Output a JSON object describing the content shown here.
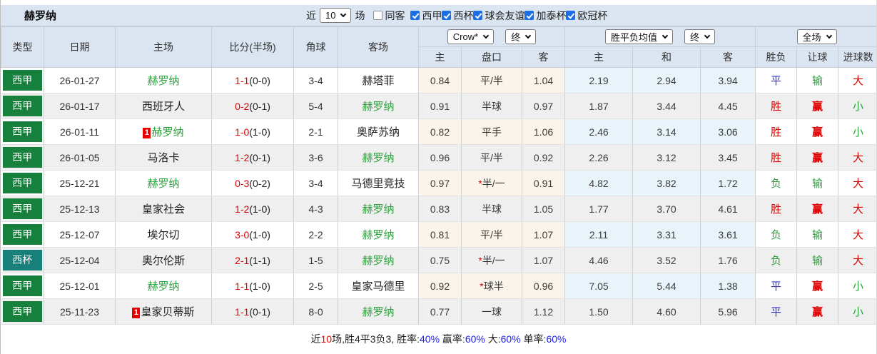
{
  "title": "赫罗纳",
  "filters": {
    "recent_label": "近",
    "recent_value": "10",
    "matches_label": "场",
    "same_away_label": "同客",
    "same_away_checked": false,
    "competitions": [
      {
        "label": "西甲",
        "checked": true
      },
      {
        "label": "西杯",
        "checked": true
      },
      {
        "label": "球会友谊",
        "checked": true
      },
      {
        "label": "加泰杯",
        "checked": true
      },
      {
        "label": "欧冠杯",
        "checked": true
      }
    ]
  },
  "controls": {
    "odds_source": "Crow*",
    "odds_source_time": "终",
    "avg_source": "胜平负均值",
    "avg_source_time": "终",
    "scope": "全场"
  },
  "columns": {
    "type": "类型",
    "date": "日期",
    "home": "主场",
    "score": "比分(半场)",
    "corner": "角球",
    "away": "客场",
    "odds_home": "主",
    "odds_handicap": "盘口",
    "odds_away": "客",
    "avg_home": "主",
    "avg_draw": "和",
    "avg_away": "客",
    "result": "胜负",
    "handicap_result": "让球",
    "goals": "进球数"
  },
  "rows": [
    {
      "comp": "西甲",
      "comp_type": "league",
      "date": "26-01-27",
      "home": "赫罗纳",
      "home_self": true,
      "home_card": "",
      "score": "1-1",
      "half": "(0-0)",
      "corners": "3-4",
      "away": "赫塔菲",
      "away_self": false,
      "odds_home": "0.84",
      "handicap": "平/半",
      "handicap_star": false,
      "odds_away": "1.04",
      "avg_home": "2.19",
      "avg_draw": "2.94",
      "avg_away": "3.94",
      "result": "平",
      "handicap_result": "输",
      "goals": "大"
    },
    {
      "comp": "西甲",
      "comp_type": "league",
      "date": "26-01-17",
      "home": "西班牙人",
      "home_self": false,
      "home_card": "",
      "score": "0-2",
      "half": "(0-1)",
      "corners": "5-4",
      "away": "赫罗纳",
      "away_self": true,
      "odds_home": "0.91",
      "handicap": "半球",
      "handicap_star": false,
      "odds_away": "0.97",
      "avg_home": "1.87",
      "avg_draw": "3.44",
      "avg_away": "4.45",
      "result": "胜",
      "handicap_result": "赢",
      "goals": "小"
    },
    {
      "comp": "西甲",
      "comp_type": "league",
      "date": "26-01-11",
      "home": "赫罗纳",
      "home_self": true,
      "home_card": "1",
      "score": "1-0",
      "half": "(1-0)",
      "corners": "2-1",
      "away": "奥萨苏纳",
      "away_self": false,
      "odds_home": "0.82",
      "handicap": "平手",
      "handicap_star": false,
      "odds_away": "1.06",
      "avg_home": "2.46",
      "avg_draw": "3.14",
      "avg_away": "3.06",
      "result": "胜",
      "handicap_result": "赢",
      "goals": "小"
    },
    {
      "comp": "西甲",
      "comp_type": "league",
      "date": "26-01-05",
      "home": "马洛卡",
      "home_self": false,
      "home_card": "",
      "score": "1-2",
      "half": "(0-1)",
      "corners": "3-6",
      "away": "赫罗纳",
      "away_self": true,
      "odds_home": "0.96",
      "handicap": "平/半",
      "handicap_star": false,
      "odds_away": "0.92",
      "avg_home": "2.26",
      "avg_draw": "3.12",
      "avg_away": "3.45",
      "result": "胜",
      "handicap_result": "赢",
      "goals": "大"
    },
    {
      "comp": "西甲",
      "comp_type": "league",
      "date": "25-12-21",
      "home": "赫罗纳",
      "home_self": true,
      "home_card": "",
      "score": "0-3",
      "half": "(0-2)",
      "corners": "3-4",
      "away": "马德里竞技",
      "away_self": false,
      "odds_home": "0.97",
      "handicap": "半/一",
      "handicap_star": true,
      "odds_away": "0.91",
      "avg_home": "4.82",
      "avg_draw": "3.82",
      "avg_away": "1.72",
      "result": "负",
      "handicap_result": "输",
      "goals": "大"
    },
    {
      "comp": "西甲",
      "comp_type": "league",
      "date": "25-12-13",
      "home": "皇家社会",
      "home_self": false,
      "home_card": "",
      "score": "1-2",
      "half": "(1-0)",
      "corners": "4-3",
      "away": "赫罗纳",
      "away_self": true,
      "odds_home": "0.83",
      "handicap": "半球",
      "handicap_star": false,
      "odds_away": "1.05",
      "avg_home": "1.77",
      "avg_draw": "3.70",
      "avg_away": "4.61",
      "result": "胜",
      "handicap_result": "赢",
      "goals": "大"
    },
    {
      "comp": "西甲",
      "comp_type": "league",
      "date": "25-12-07",
      "home": "埃尔切",
      "home_self": false,
      "home_card": "",
      "score": "3-0",
      "half": "(1-0)",
      "corners": "2-2",
      "away": "赫罗纳",
      "away_self": true,
      "odds_home": "0.81",
      "handicap": "平/半",
      "handicap_star": false,
      "odds_away": "1.07",
      "avg_home": "2.11",
      "avg_draw": "3.31",
      "avg_away": "3.61",
      "result": "负",
      "handicap_result": "输",
      "goals": "大"
    },
    {
      "comp": "西杯",
      "comp_type": "cup",
      "date": "25-12-04",
      "home": "奥尔伦斯",
      "home_self": false,
      "home_card": "",
      "score": "2-1",
      "half": "(1-1)",
      "corners": "1-5",
      "away": "赫罗纳",
      "away_self": true,
      "odds_home": "0.75",
      "handicap": "半/一",
      "handicap_star": true,
      "odds_away": "1.07",
      "avg_home": "4.46",
      "avg_draw": "3.52",
      "avg_away": "1.76",
      "result": "负",
      "handicap_result": "输",
      "goals": "大"
    },
    {
      "comp": "西甲",
      "comp_type": "league",
      "date": "25-12-01",
      "home": "赫罗纳",
      "home_self": true,
      "home_card": "",
      "score": "1-1",
      "half": "(1-0)",
      "corners": "2-5",
      "away": "皇家马德里",
      "away_self": false,
      "odds_home": "0.92",
      "handicap": "球半",
      "handicap_star": true,
      "odds_away": "0.96",
      "avg_home": "7.05",
      "avg_draw": "5.44",
      "avg_away": "1.38",
      "result": "平",
      "handicap_result": "赢",
      "goals": "小"
    },
    {
      "comp": "西甲",
      "comp_type": "league",
      "date": "25-11-23",
      "home": "皇家贝蒂斯",
      "home_self": false,
      "home_card": "1",
      "score": "1-1",
      "half": "(0-1)",
      "corners": "8-0",
      "away": "赫罗纳",
      "away_self": true,
      "odds_home": "0.77",
      "handicap": "一球",
      "handicap_star": false,
      "odds_away": "1.12",
      "avg_home": "1.50",
      "avg_draw": "4.60",
      "avg_away": "5.96",
      "result": "平",
      "handicap_result": "赢",
      "goals": "小"
    }
  ],
  "footer": {
    "prefix": "近",
    "count": "10",
    "summary": "场,胜4平3负3, 胜率:",
    "win_rate": "40%",
    "handicap_label": " 赢率:",
    "handicap_rate": "60%",
    "big_label": " 大:",
    "big_rate": "60%",
    "single_label": " 单率:",
    "single_rate": "60%"
  },
  "colors": {
    "header_bg": "#dbe5f1",
    "league_green": "#17803d",
    "cup_teal": "#17807a",
    "red": "#dd0000",
    "green": "#2ca13c",
    "blue": "#3333cc",
    "link_blue": "#2222ee",
    "cream_bg": "#faf4ea",
    "lightblue_bg": "#e9f3fa",
    "alt_row": "#efefef"
  }
}
